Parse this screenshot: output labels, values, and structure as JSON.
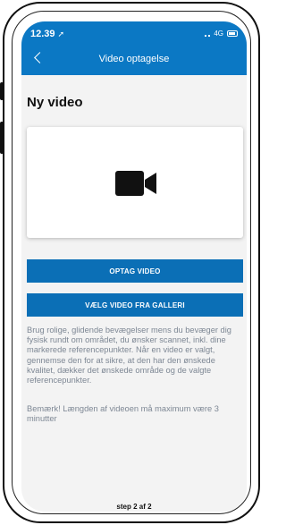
{
  "status_bar": {
    "time": "12.39",
    "network": "4G"
  },
  "header": {
    "title": "Video optagelse"
  },
  "page_title": "Ny video",
  "buttons": {
    "record": "OPTAG VIDEO",
    "gallery": "VÆLG VIDEO FRA GALLERI"
  },
  "description": "Brug rolige, glidende bevægelser mens du bevæger dig fysisk rundt om området, du ønsker scannet, inkl. dine markerede referencepunkter. Når en video er valgt, gennemse den for at sikre, at den har den ønskede kvalitet, dækker det ønskede område og de valgte referencepunkter.",
  "note": "Bemærk! Længden af videoen må maximum være 3 minutter",
  "step_indicator": "step 2 af 2",
  "colors": {
    "accent": "#0b78c4",
    "button": "#0b6fb6",
    "body_text": "#7d8794"
  },
  "icons": {
    "preview": "video-camera-icon",
    "back": "chevron-left-icon",
    "location": "location-arrow-icon"
  }
}
